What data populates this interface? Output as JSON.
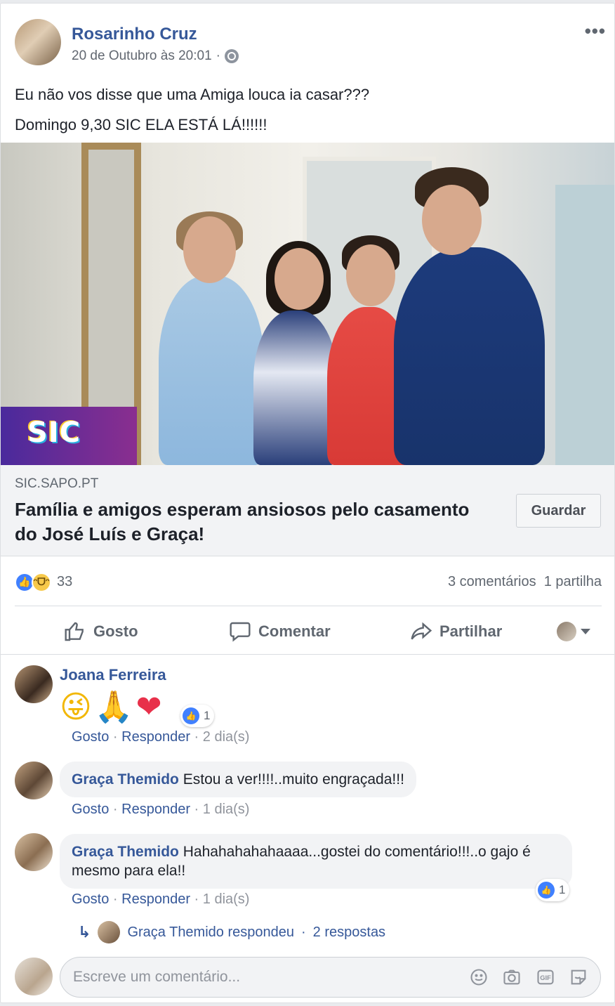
{
  "post": {
    "author": "Rosarinho Cruz",
    "timestamp": "20 de Outubro às 20:01",
    "separator": "·",
    "more_label": "•••",
    "text_lines": [
      "Eu não vos disse que uma Amiga louca ia casar???",
      "Domingo 9,30 SIC ELA ESTÁ LÁ!!!!!!"
    ],
    "image_logo_text": "SIC"
  },
  "link_preview": {
    "domain": "SIC.SAPO.PT",
    "title": "Família e amigos esperam ansiosos pelo casamento do José Luís e Graça!",
    "save_label": "Guardar"
  },
  "stats": {
    "reaction_count": "33",
    "comments": "3 comentários",
    "shares": "1 partilha"
  },
  "actions": {
    "like": "Gosto",
    "comment": "Comentar",
    "share": "Partilhar"
  },
  "comments": [
    {
      "author": "Joana Ferreira",
      "emojis": [
        "😜",
        "🙏",
        "❤"
      ],
      "reaction_count": "1",
      "like": "Gosto",
      "reply": "Responder",
      "time": "2 dia(s)"
    },
    {
      "author": "Graça Themido",
      "text": "Estou a ver!!!!..muito engraçada!!!",
      "like": "Gosto",
      "reply": "Responder",
      "time": "1 dia(s)"
    },
    {
      "author": "Graça Themido",
      "text": "Hahahahahahaaaa...gostei do comentário!!!..o gajo é mesmo para ela!!",
      "reaction_count": "1",
      "like": "Gosto",
      "reply": "Responder",
      "time": "1 dia(s)"
    }
  ],
  "replies_summary": {
    "author_action": "Graça Themido respondeu",
    "count": "2 respostas"
  },
  "composer": {
    "placeholder": "Escreve um comentário...",
    "gif_label": "GIF"
  },
  "colors": {
    "link_blue": "#365899",
    "like_blue": "#4080ff",
    "muted_text": "#606770",
    "bubble_bg": "#f2f3f5"
  }
}
